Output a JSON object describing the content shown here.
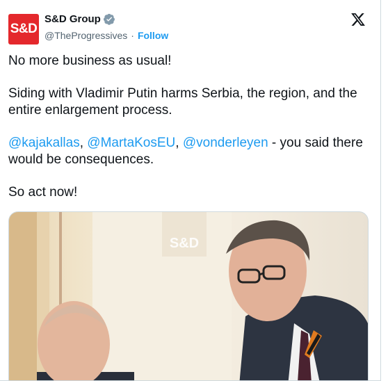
{
  "author": {
    "avatar_text": "S&D",
    "name": "S&D Group",
    "handle": "@TheProgressives",
    "separator": "·",
    "follow_label": "Follow"
  },
  "tweet": {
    "line1": "No more business as usual!",
    "line2": "Siding with Vladimir Putin harms Serbia, the region, and the entire enlargement process.",
    "mention1": "@kajakallas",
    "comma1": ", ",
    "mention2": "@MartaKosEU",
    "comma2": ", ",
    "mention3": "@vonderleyen",
    "line3_rest": " - you said there would be consequences.",
    "line4": "So act now!"
  },
  "media": {
    "watermark": "S&D"
  },
  "colors": {
    "accent": "#1d9bf0",
    "brand_red": "#e4282c"
  },
  "icons": [
    "verified-badge-icon",
    "x-logo-icon"
  ]
}
